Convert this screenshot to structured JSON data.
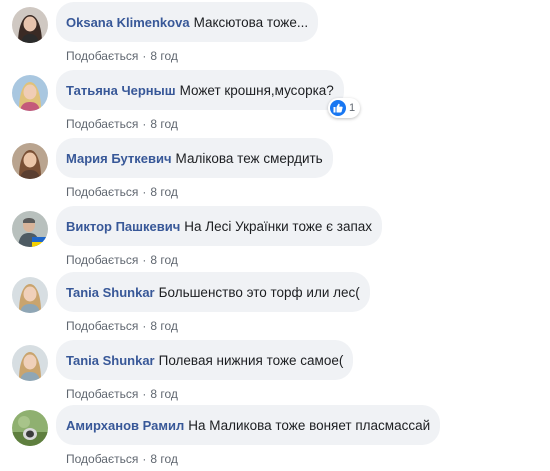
{
  "comments": [
    {
      "author": "Oksana Klimenkova",
      "text": "Максютова тоже...",
      "like_label": "Подобається",
      "separator": "·",
      "time": "8 год",
      "avatar": "avatar-woman-dark-hair"
    },
    {
      "author": "Татьяна Черныш",
      "text": "Может крошня,мусорка?",
      "like_label": "Подобається",
      "separator": "·",
      "time": "8 год",
      "avatar": "avatar-woman-blonde",
      "reaction": {
        "icon": "like-thumb-icon",
        "count": "1"
      }
    },
    {
      "author": "Мария Буткевич",
      "text": "Малікова теж смердить",
      "like_label": "Подобається",
      "separator": "·",
      "time": "8 год",
      "avatar": "avatar-woman-brown-hair"
    },
    {
      "author": "Виктор Пашкевич",
      "text": "На Лесі Українки тоже є запах",
      "like_label": "Подобається",
      "separator": "·",
      "time": "8 год",
      "avatar": "avatar-man-ukraine-flag"
    },
    {
      "author": "Tania Shunkar",
      "text": "Большенство это торф или лес(",
      "like_label": "Подобається",
      "separator": "·",
      "time": "8 год",
      "avatar": "avatar-woman-light-hair"
    },
    {
      "author": "Tania Shunkar",
      "text": "Полевая нижния тоже самое(",
      "like_label": "Подобається",
      "separator": "·",
      "time": "8 год",
      "avatar": "avatar-woman-light-hair"
    },
    {
      "author": "Амирханов Рамил",
      "text": "На Маликова тоже воняет пласмассай",
      "like_label": "Подобається",
      "separator": "·",
      "time": "8 год",
      "avatar": "avatar-outdoor-green"
    }
  ],
  "colors": {
    "author": "#385898",
    "text": "#1c1e21",
    "meta": "#606770",
    "bubble": "#f0f2f5",
    "like_blue": "#1877f2"
  }
}
